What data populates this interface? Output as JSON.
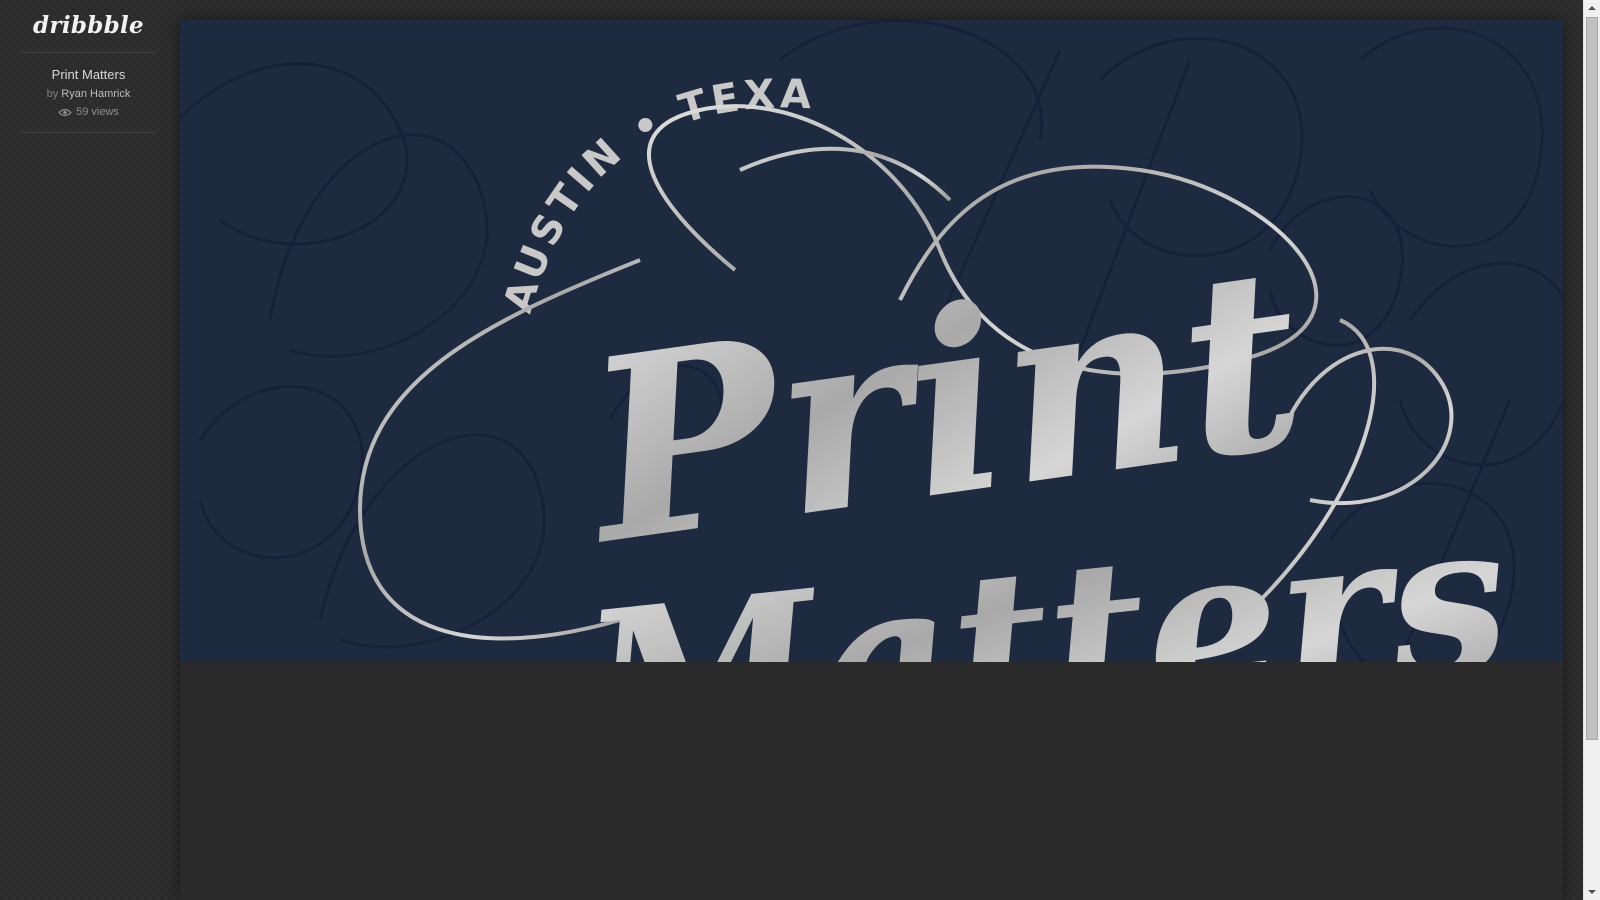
{
  "logo": {
    "text": "dribbble"
  },
  "shot": {
    "title": "Print Matters",
    "by_prefix": "by",
    "author": "Ryan Hamrick",
    "views": "59 views",
    "image_text": {
      "location": "AUSTIN • TEXAS",
      "headline_line1": "Print",
      "headline_line2": "Matters"
    }
  },
  "colors": {
    "background": "#2b2b2b",
    "image_background": "#1e2a40",
    "lettering": "#c9c9c9"
  },
  "icons": {
    "views": "eye-icon"
  }
}
